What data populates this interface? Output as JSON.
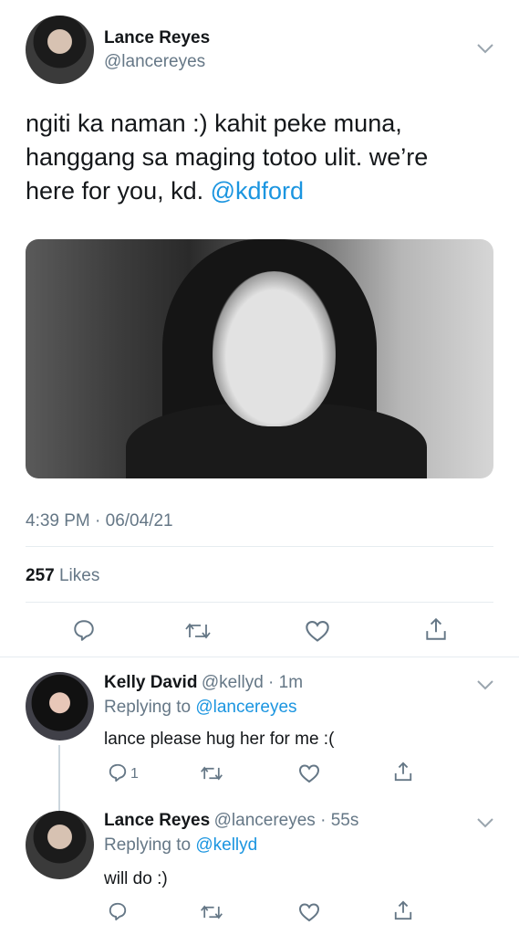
{
  "main_tweet": {
    "display_name": "Lance Reyes",
    "handle": "@lancereyes",
    "text_line1": "ngiti ka naman :) kahit peke muna,",
    "text_line2": "hanggang sa maging totoo ulit. we’re",
    "text_line3": "here for you, kd. ",
    "mention": "@kdford",
    "timestamp": "4:39 PM · 06/04/21",
    "likes_count": "257",
    "likes_label": "Likes"
  },
  "replies": [
    {
      "display_name": "Kelly David",
      "handle_time": "@kellyd · 1m",
      "replying_label": "Replying to ",
      "replying_to": "@lancereyes",
      "text": "lance please hug her for me :(",
      "reply_count": "1"
    },
    {
      "display_name": "Lance Reyes",
      "handle_time": "@lancereyes · 55s",
      "replying_label": "Replying to ",
      "replying_to": "@kellyd",
      "text": "will do :)"
    }
  ],
  "icons": {
    "reply": "reply-icon",
    "retweet": "retweet-icon",
    "like": "heart-icon",
    "share": "share-icon",
    "more": "chevron-down-icon"
  },
  "colors": {
    "accent": "#1b95e0",
    "secondary_text": "#657786",
    "divider": "#e6ecf0"
  }
}
